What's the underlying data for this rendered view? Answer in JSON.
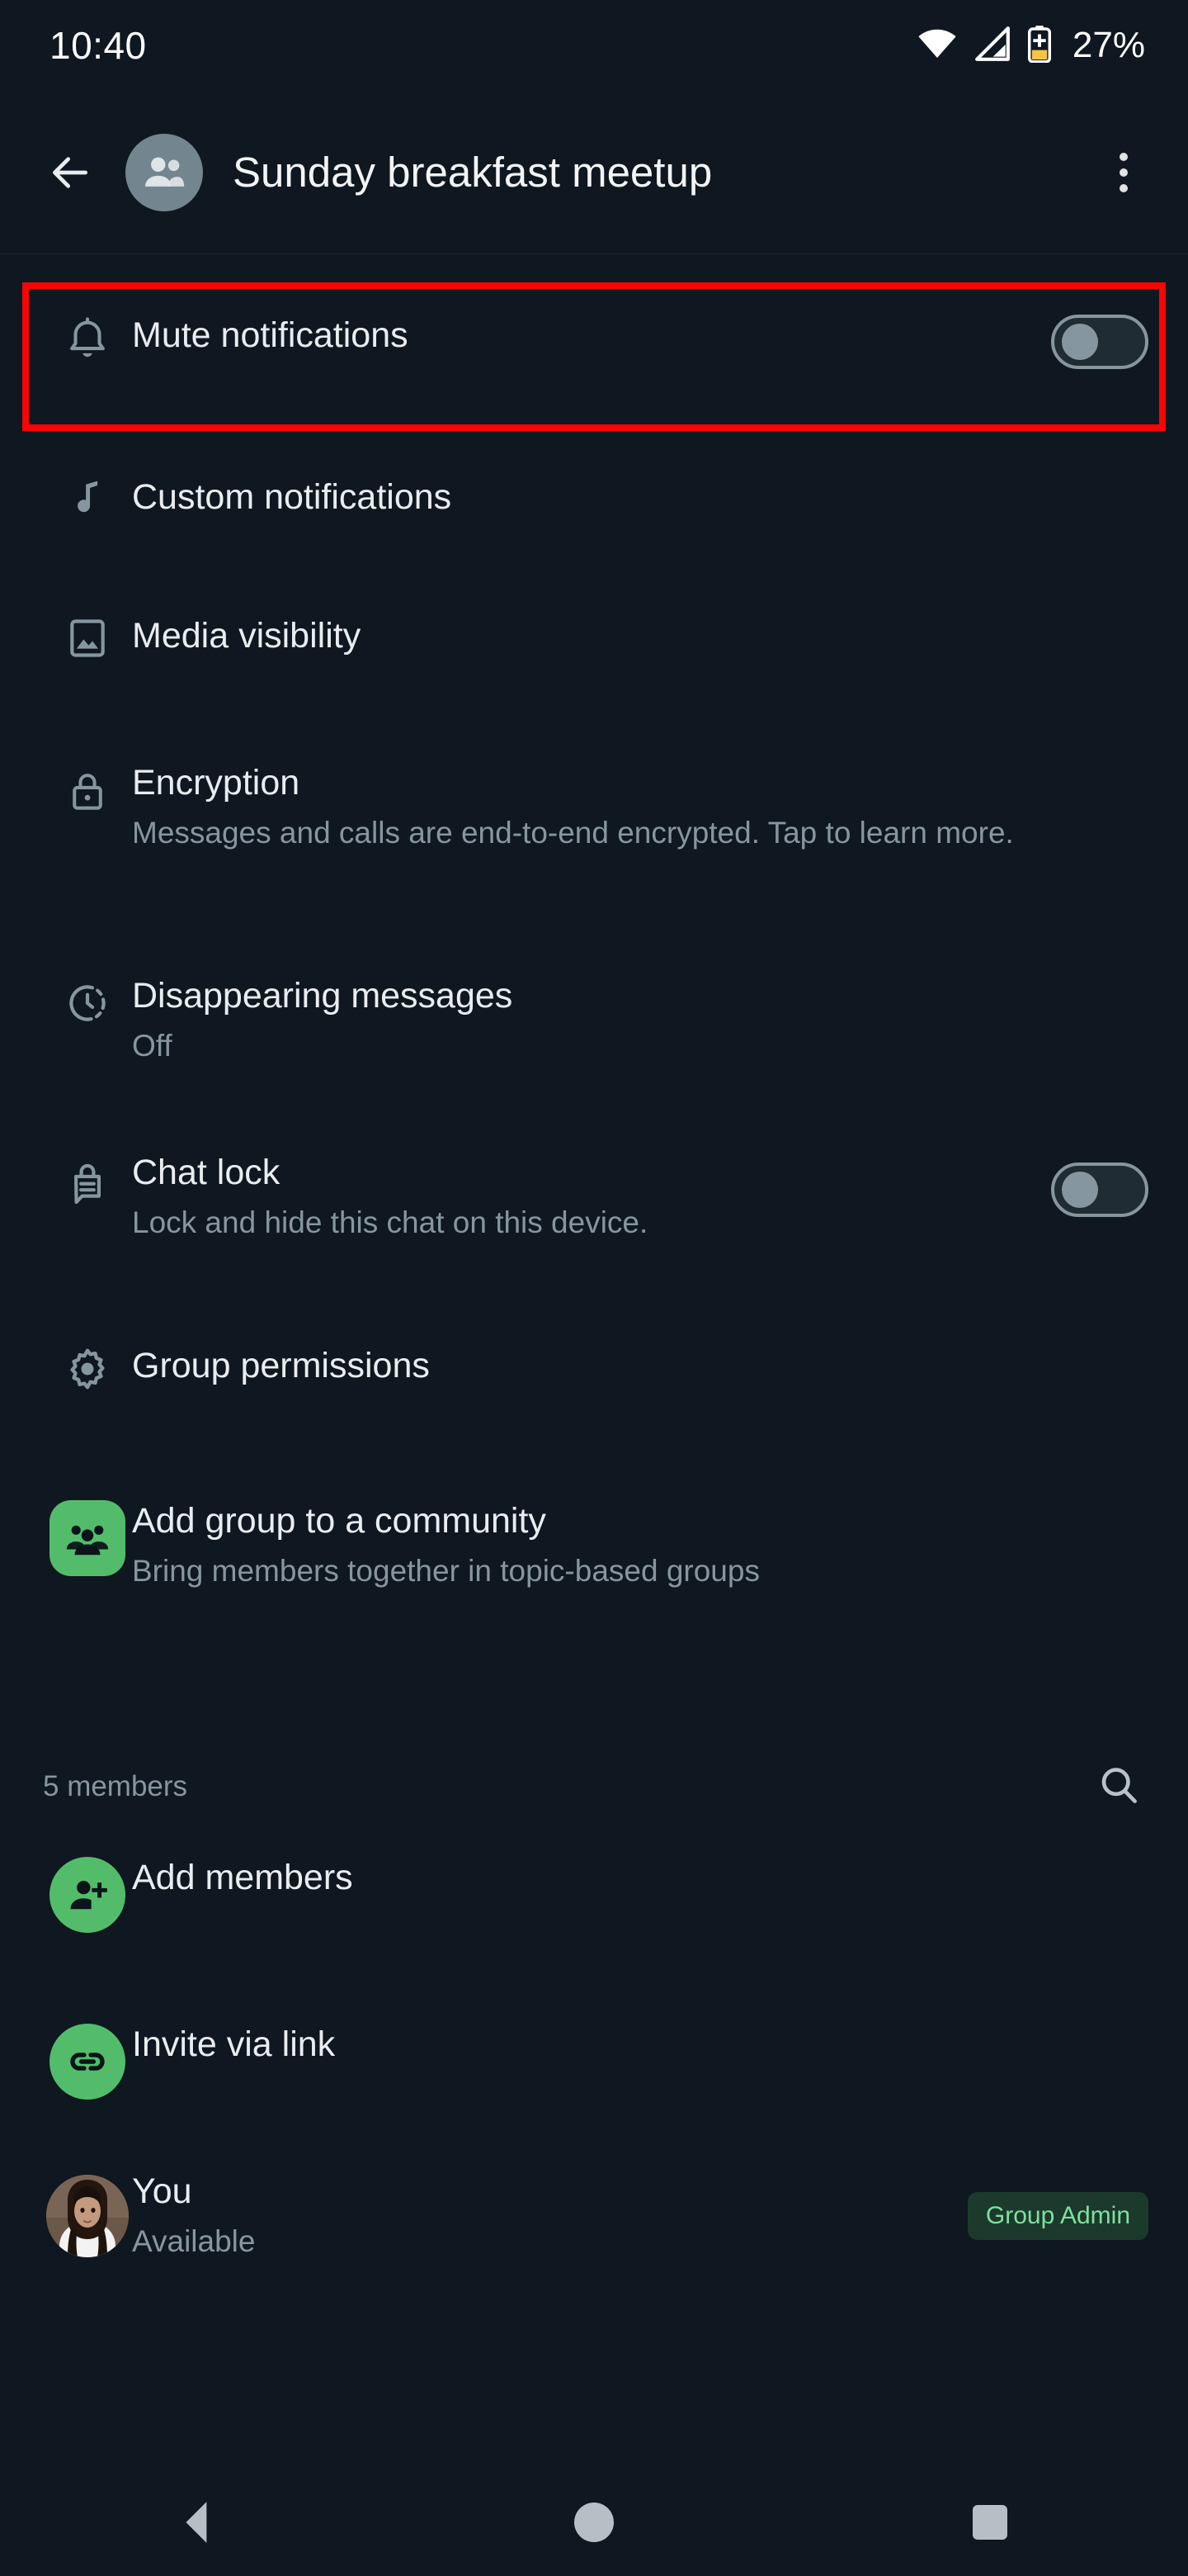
{
  "status_bar": {
    "time": "10:40",
    "battery_percent": "27%",
    "icons": [
      "wifi-icon",
      "cellular-signal-icon",
      "battery-saver-icon"
    ],
    "battery_color": "#f5c542"
  },
  "app_bar": {
    "back_icon": "back-arrow-icon",
    "avatar_icon": "group-avatar-icon",
    "title": "Sunday breakfast meetup",
    "overflow_icon": "overflow-menu-icon"
  },
  "highlight": {
    "color": "#fb0404",
    "target": "Mute notifications"
  },
  "settings": [
    {
      "key": "mute-notifications",
      "icon": "bell-icon",
      "title": "Mute notifications",
      "subtitle": "",
      "control": "toggle",
      "toggle_on": false
    },
    {
      "key": "custom-notifications",
      "icon": "music-note-icon",
      "title": "Custom notifications",
      "subtitle": "",
      "control": "none"
    },
    {
      "key": "media-visibility",
      "icon": "image-icon",
      "title": "Media visibility",
      "subtitle": "",
      "control": "none"
    },
    {
      "key": "encryption",
      "icon": "lock-icon",
      "title": "Encryption",
      "subtitle": "Messages and calls are end-to-end encrypted. Tap to learn more.",
      "control": "none"
    },
    {
      "key": "disappearing-messages",
      "icon": "timer-icon",
      "title": "Disappearing messages",
      "subtitle": "Off",
      "control": "none"
    },
    {
      "key": "chat-lock",
      "icon": "chat-lock-icon",
      "title": "Chat lock",
      "subtitle": "Lock and hide this chat on this device.",
      "control": "toggle",
      "toggle_on": false
    },
    {
      "key": "group-permissions",
      "icon": "gear-icon",
      "title": "Group permissions",
      "subtitle": "",
      "control": "none"
    }
  ],
  "community": {
    "icon": "community-icon",
    "title": "Add group to a community",
    "subtitle": "Bring members together in topic-based groups",
    "accent": "#53bc6b"
  },
  "members_section": {
    "count_label": "5 members",
    "search_icon": "search-icon",
    "actions": [
      {
        "key": "add-members",
        "icon": "person-add-icon",
        "title": "Add members"
      },
      {
        "key": "invite-via-link",
        "icon": "link-icon",
        "title": "Invite via link"
      }
    ],
    "members": [
      {
        "key": "member-you",
        "avatar": "user-photo-avatar",
        "name": "You",
        "status": "Available",
        "badge": "Group Admin"
      }
    ]
  },
  "nav_bar": {
    "back": "nav-back-icon",
    "home": "nav-home-icon",
    "recents": "nav-recents-icon"
  }
}
